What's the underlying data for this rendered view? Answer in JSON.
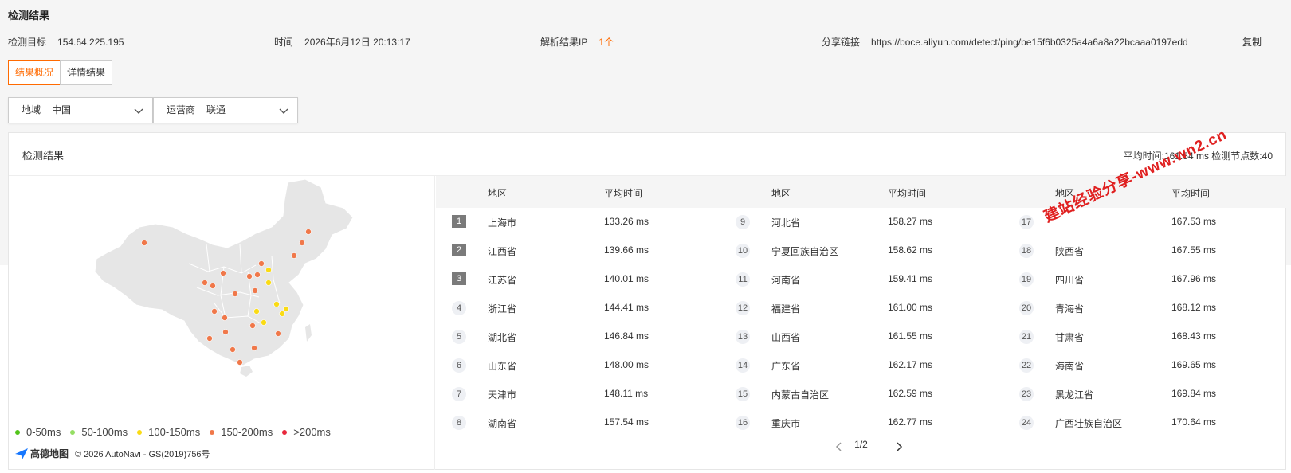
{
  "page_title": "检测结果",
  "meta": {
    "target_label": "检测目标",
    "target_value": "154.64.225.195",
    "time_label": "时间",
    "time_value": "2026年6月12日 20:13:17",
    "ip_label": "解析结果IP",
    "ip_count": "1个",
    "share_label": "分享链接",
    "share_url": "https://boce.aliyun.com/detect/ping/be15f6b0325a4a6a8a22bcaaa0197edd",
    "copy_label": "复制"
  },
  "tabs": [
    {
      "label": "结果概况",
      "active": true
    },
    {
      "label": "详情结果",
      "active": false
    }
  ],
  "filters": {
    "region_label": "地域",
    "region_value": "中国",
    "isp_label": "运营商",
    "isp_value": "联通"
  },
  "panel": {
    "title": "检测结果",
    "summary": "平均时间:161.54 ms   检测节点数:40"
  },
  "table_headers": {
    "region": "地区",
    "avg": "平均时间"
  },
  "rows": [
    {
      "rank": "1",
      "region": "上海市",
      "avg": "133.26 ms"
    },
    {
      "rank": "2",
      "region": "江西省",
      "avg": "139.66 ms"
    },
    {
      "rank": "3",
      "region": "江苏省",
      "avg": "140.01 ms"
    },
    {
      "rank": "4",
      "region": "浙江省",
      "avg": "144.41 ms"
    },
    {
      "rank": "5",
      "region": "湖北省",
      "avg": "146.84 ms"
    },
    {
      "rank": "6",
      "region": "山东省",
      "avg": "148.00 ms"
    },
    {
      "rank": "7",
      "region": "天津市",
      "avg": "148.11 ms"
    },
    {
      "rank": "8",
      "region": "湖南省",
      "avg": "157.54 ms"
    },
    {
      "rank": "9",
      "region": "河北省",
      "avg": "158.27 ms"
    },
    {
      "rank": "10",
      "region": "宁夏回族自治区",
      "avg": "158.62 ms"
    },
    {
      "rank": "11",
      "region": "河南省",
      "avg": "159.41 ms"
    },
    {
      "rank": "12",
      "region": "福建省",
      "avg": "161.00 ms"
    },
    {
      "rank": "13",
      "region": "山西省",
      "avg": "161.55 ms"
    },
    {
      "rank": "14",
      "region": "广东省",
      "avg": "162.17 ms"
    },
    {
      "rank": "15",
      "region": "内蒙古自治区",
      "avg": "162.59 ms"
    },
    {
      "rank": "16",
      "region": "重庆市",
      "avg": "162.77 ms"
    },
    {
      "rank": "17",
      "region": "",
      "avg": "167.53 ms"
    },
    {
      "rank": "18",
      "region": "陕西省",
      "avg": "167.55 ms"
    },
    {
      "rank": "19",
      "region": "四川省",
      "avg": "167.96 ms"
    },
    {
      "rank": "20",
      "region": "青海省",
      "avg": "168.12 ms"
    },
    {
      "rank": "21",
      "region": "甘肃省",
      "avg": "168.43 ms"
    },
    {
      "rank": "22",
      "region": "海南省",
      "avg": "169.65 ms"
    },
    {
      "rank": "23",
      "region": "黑龙江省",
      "avg": "169.84 ms"
    },
    {
      "rank": "24",
      "region": "广西壮族自治区",
      "avg": "170.64 ms"
    }
  ],
  "legend": [
    {
      "label": "0-50ms",
      "color": "#52c41a"
    },
    {
      "label": "50-100ms",
      "color": "#95de64"
    },
    {
      "label": "100-150ms",
      "color": "#fadb14"
    },
    {
      "label": "150-200ms",
      "color": "#f0784a"
    },
    {
      "label": ">200ms",
      "color": "#e8283c"
    }
  ],
  "map_brand": {
    "logo": "高德地图",
    "copyright": "© 2026 AutoNavi - GS(2019)756号"
  },
  "pagination": {
    "text": "1/2"
  },
  "watermark": "建站经验分享-www.wn2.cn",
  "colors": {
    "accent": "#ff6a00",
    "map_fill": "#e6e6e6",
    "dot_yellow": "#fadb14",
    "dot_orange": "#f0784a"
  }
}
